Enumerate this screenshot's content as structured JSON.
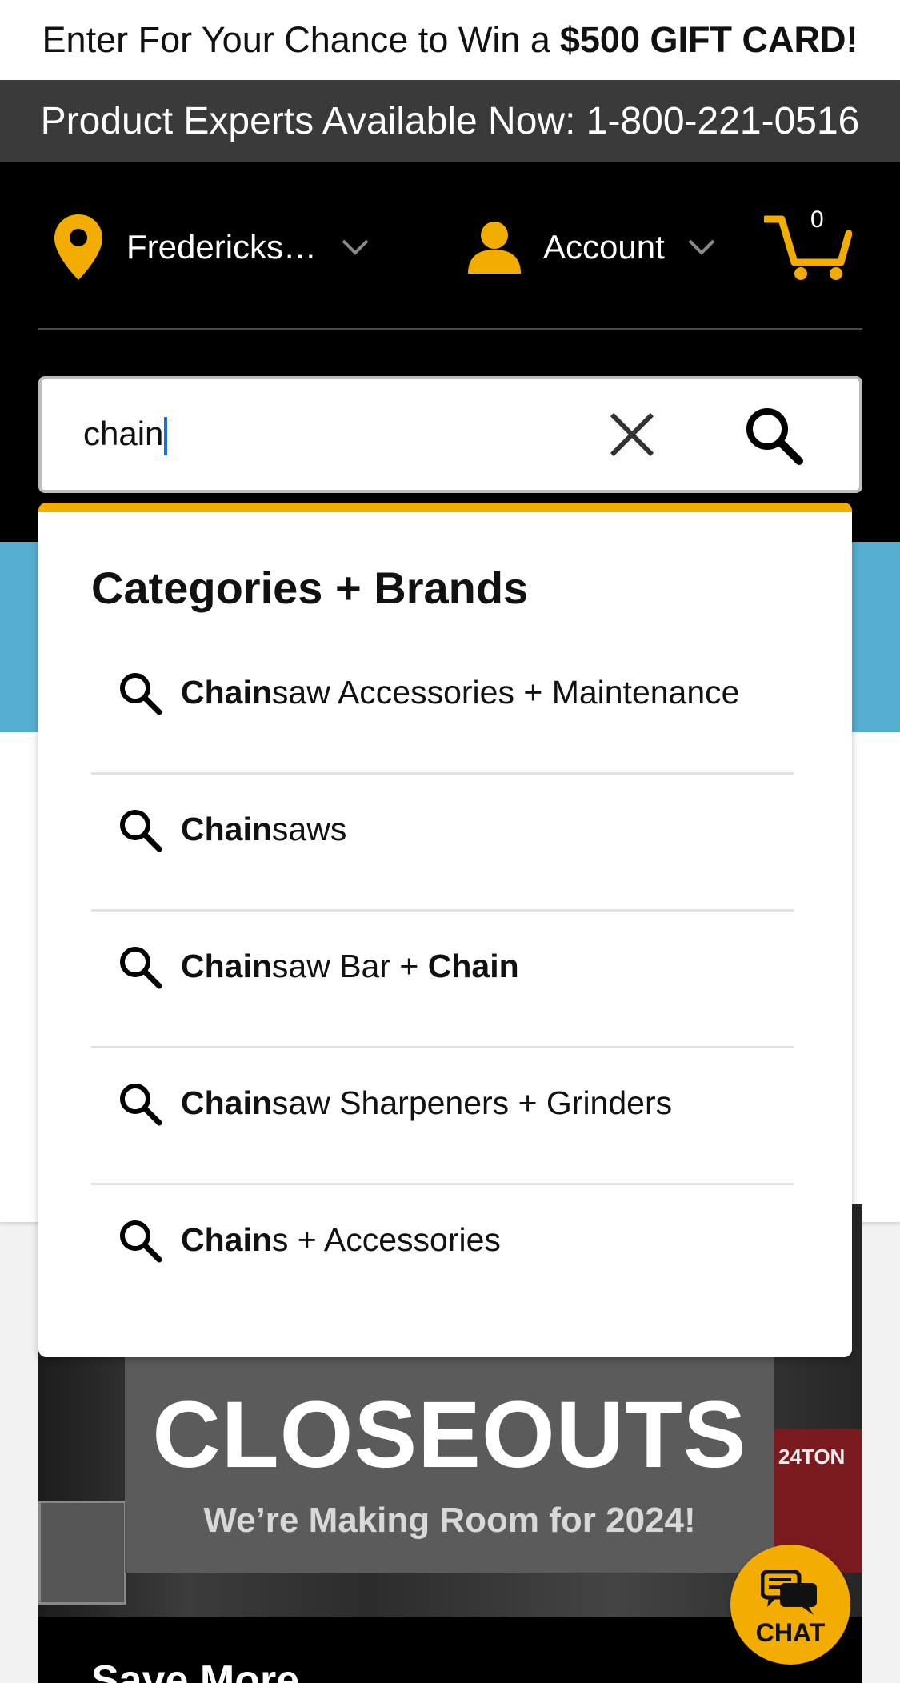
{
  "promo": {
    "prefix": "Enter For Your Chance to Win a",
    "highlight": "$500 GIFT CARD!"
  },
  "experts": {
    "text": "Product Experts Available Now: 1-800-221-0516"
  },
  "header": {
    "location_label": "Fredericks…",
    "account_label": "Account",
    "cart_count": "0",
    "accent_color": "#f3ac00"
  },
  "search": {
    "value": "chain"
  },
  "dropdown": {
    "heading": "Categories + Brands",
    "suggestions": [
      {
        "parts": [
          {
            "b": "Chain"
          },
          {
            "t": "saw Accessories + Maintenance"
          }
        ]
      },
      {
        "parts": [
          {
            "b": "Chain"
          },
          {
            "t": "saws"
          }
        ]
      },
      {
        "parts": [
          {
            "b": "Chain"
          },
          {
            "t": "saw Bar + "
          },
          {
            "b": "Chain"
          }
        ]
      },
      {
        "parts": [
          {
            "b": "Chain"
          },
          {
            "t": "saw Sharpeners + Grinders"
          }
        ]
      },
      {
        "parts": [
          {
            "b": "Chain"
          },
          {
            "t": "s + Accessories"
          }
        ]
      }
    ]
  },
  "banner": {
    "title": "CLOSEOUTS",
    "subtitle": "We’re Making Room for 2024!",
    "brand_text": "24TON"
  },
  "save_more": {
    "title": "Save More"
  },
  "chat": {
    "label": "CHAT"
  }
}
